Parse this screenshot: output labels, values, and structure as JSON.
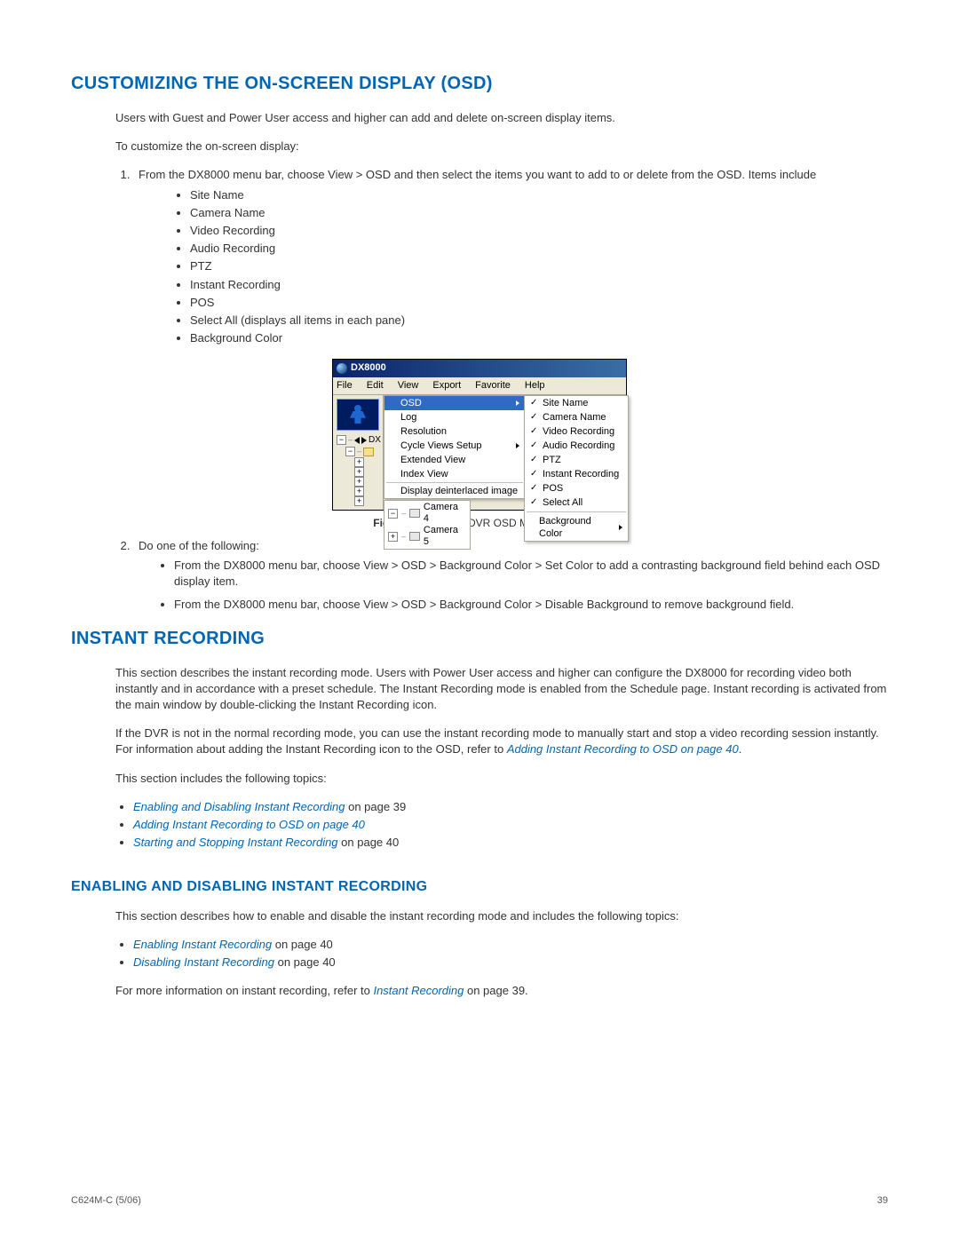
{
  "section1": {
    "heading": "CUSTOMIZING THE ON-SCREEN DISPLAY (OSD)",
    "intro": "Users with Guest and Power User access and higher can add and delete on-screen display items.",
    "lead": "To customize the on-screen display:",
    "step1": "From the DX8000 menu bar, choose View > OSD and then select the items you want to add to or delete from the OSD. Items include",
    "items": [
      "Site Name",
      "Camera Name",
      "Video Recording",
      "Audio Recording",
      "PTZ",
      "Instant Recording",
      "POS",
      "Select All (displays all items in each pane)",
      "Background Color"
    ],
    "step2": "Do one of the following:",
    "step2a": "From the DX8000 menu bar, choose View > OSD > Background Color > Set Color to add a contrasting background field behind each OSD display item.",
    "step2b": "From the DX8000 menu bar, choose View > OSD > Background Color > Disable Background to remove background field."
  },
  "figure": {
    "label": "Figure 13.",
    "caption": "DX8000 DVR OSD Menu Options",
    "window_title": "DX8000",
    "menubar": [
      "File",
      "Edit",
      "View",
      "Export",
      "Favorite",
      "Help"
    ],
    "tree_root": "DX",
    "view_menu": [
      "OSD",
      "Log",
      "Resolution",
      "Cycle Views Setup",
      "Extended View",
      "Index View",
      "Display deinterlaced image"
    ],
    "osd_submenu": [
      "Site Name",
      "Camera Name",
      "Video Recording",
      "Audio Recording",
      "PTZ",
      "Instant Recording",
      "POS",
      "Select All"
    ],
    "osd_bg": "Background Color",
    "cameras": [
      "Camera 4",
      "Camera 5"
    ]
  },
  "section2": {
    "heading": "INSTANT RECORDING",
    "p1": "This section describes the instant recording mode. Users with Power User access and higher can configure the DX8000 for recording video both instantly and in accordance with a preset schedule. The Instant Recording mode is enabled from the Schedule page. Instant recording is activated from the main window by double-clicking the Instant Recording icon.",
    "p2a": "If the DVR is not in the normal recording mode, you can use the instant recording mode to manually start and stop a video recording session instantly. For information about adding the Instant Recording icon to the OSD, refer to ",
    "p2_link": "Adding Instant Recording to OSD on page 40",
    "p2b": ".",
    "topics_intro": "This section includes the following topics:",
    "topics": [
      {
        "link": "Enabling and Disabling Instant Recording",
        "tail": " on page 39"
      },
      {
        "link": "Adding Instant Recording to OSD on page 40",
        "tail": ""
      },
      {
        "link": "Starting and Stopping Instant Recording",
        "tail": " on page 40"
      }
    ]
  },
  "section3": {
    "heading": "ENABLING AND DISABLING INSTANT RECORDING",
    "p1": "This section describes how to enable and disable the instant recording mode and includes the following topics:",
    "topics": [
      {
        "link": "Enabling Instant Recording",
        "tail": " on page 40"
      },
      {
        "link": "Disabling Instant Recording",
        "tail": " on page 40"
      }
    ],
    "p2a": "For more information on instant recording, refer to ",
    "p2_link": "Instant Recording",
    "p2b": " on page 39."
  },
  "footer": {
    "left": "C624M-C (5/06)",
    "right": "39"
  }
}
